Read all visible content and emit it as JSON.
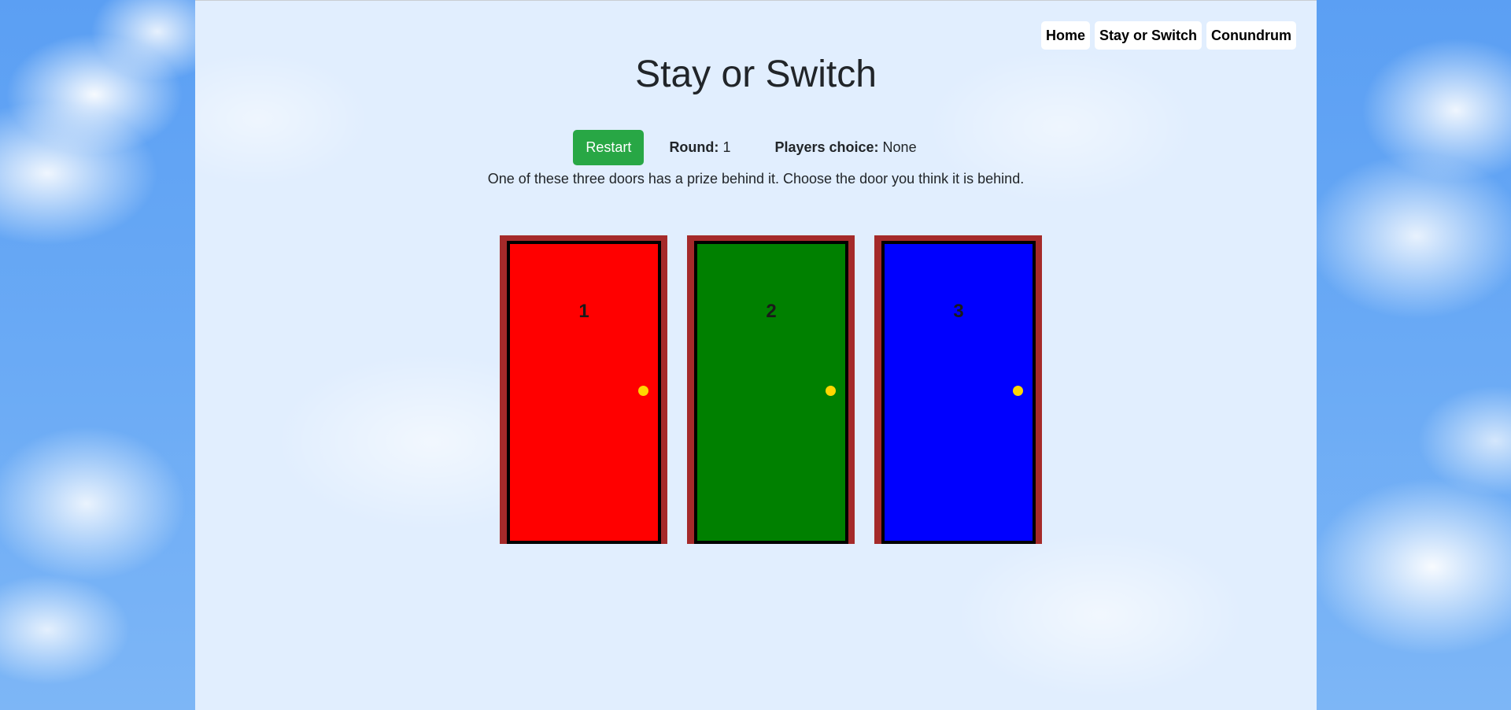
{
  "nav": {
    "items": [
      {
        "label": "Home"
      },
      {
        "label": "Stay or Switch"
      },
      {
        "label": "Conundrum"
      }
    ]
  },
  "title": "Stay or Switch",
  "controls": {
    "restart_label": "Restart",
    "round_label": "Round:",
    "round_value": "1",
    "choice_label": "Players choice:",
    "choice_value": "None"
  },
  "instructions": "One of these three doors has a prize behind it. Choose the door you think it is behind.",
  "doors": [
    {
      "number": "1",
      "color": "#ff0000"
    },
    {
      "number": "2",
      "color": "#008000"
    },
    {
      "number": "3",
      "color": "#0000ff"
    }
  ],
  "colors": {
    "frame": "#a52a2a",
    "knob": "#ffd700",
    "restart_button": "#28a745"
  }
}
